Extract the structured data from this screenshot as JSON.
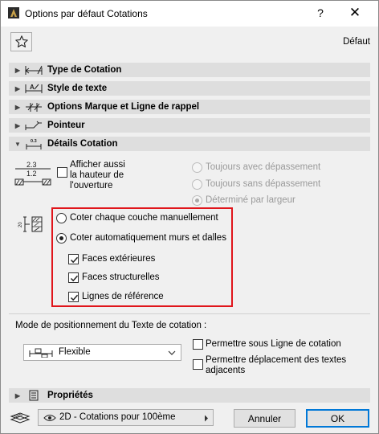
{
  "window": {
    "title": "Options par défaut Cotations",
    "help": "?",
    "close": "✕"
  },
  "toolbar": {
    "default_label": "Défaut"
  },
  "sections": [
    {
      "label": "Type de Cotation",
      "icon": "dimension-type-icon",
      "expanded": false
    },
    {
      "label": "Style de texte",
      "icon": "text-style-icon",
      "expanded": false
    },
    {
      "label": "Options Marque et Ligne de rappel",
      "icon": "marker-options-icon",
      "expanded": false
    },
    {
      "label": "Pointeur",
      "icon": "pointer-icon",
      "expanded": false
    },
    {
      "label": "Détails Cotation",
      "icon": "dimension-details-icon",
      "expanded": true
    }
  ],
  "details": {
    "icon_top": "2.3",
    "icon_bottom": "1.2",
    "opening_height_label": "Afficher aussi la hauteur de l'ouverture",
    "opening_height_lines": [
      "Afficher aussi",
      "la hauteur de",
      "l'ouverture"
    ],
    "opening_height_checked": false,
    "always_over": "Toujours avec dépassement",
    "always_without": "Toujours sans dépassement",
    "by_width": "Déterminé par largeur",
    "by_width_selected": true,
    "layers_manual": "Coter chaque couche manuellement",
    "auto_walls": "Coter automatiquement murs et dalles",
    "auto_selected": true,
    "exterior_faces": "Faces extérieures",
    "structural_faces": "Faces structurelles",
    "reference_lines": "Lignes de référence",
    "exterior_checked": true,
    "structural_checked": true,
    "reference_checked": true,
    "layer_icon_number": "20"
  },
  "positioning": {
    "label": "Mode de positionnement du Texte de cotation :",
    "mode_value": "Flexible",
    "allow_under_line": "Permettre sous Ligne de cotation",
    "allow_move_adjacent_lines": [
      "Permettre déplacement des textes",
      "adjacents"
    ],
    "allow_under_line_checked": false,
    "allow_move_checked": false
  },
  "properties_section": {
    "label": "Propriétés",
    "expanded": false
  },
  "footer": {
    "view_value": "2D - Cotations pour 100ème",
    "cancel_label": "Annuler",
    "ok_label": "OK"
  },
  "colors": {
    "highlight": "#e0151b",
    "section_bg": "#dedede",
    "ok_border": "#0078d7"
  }
}
